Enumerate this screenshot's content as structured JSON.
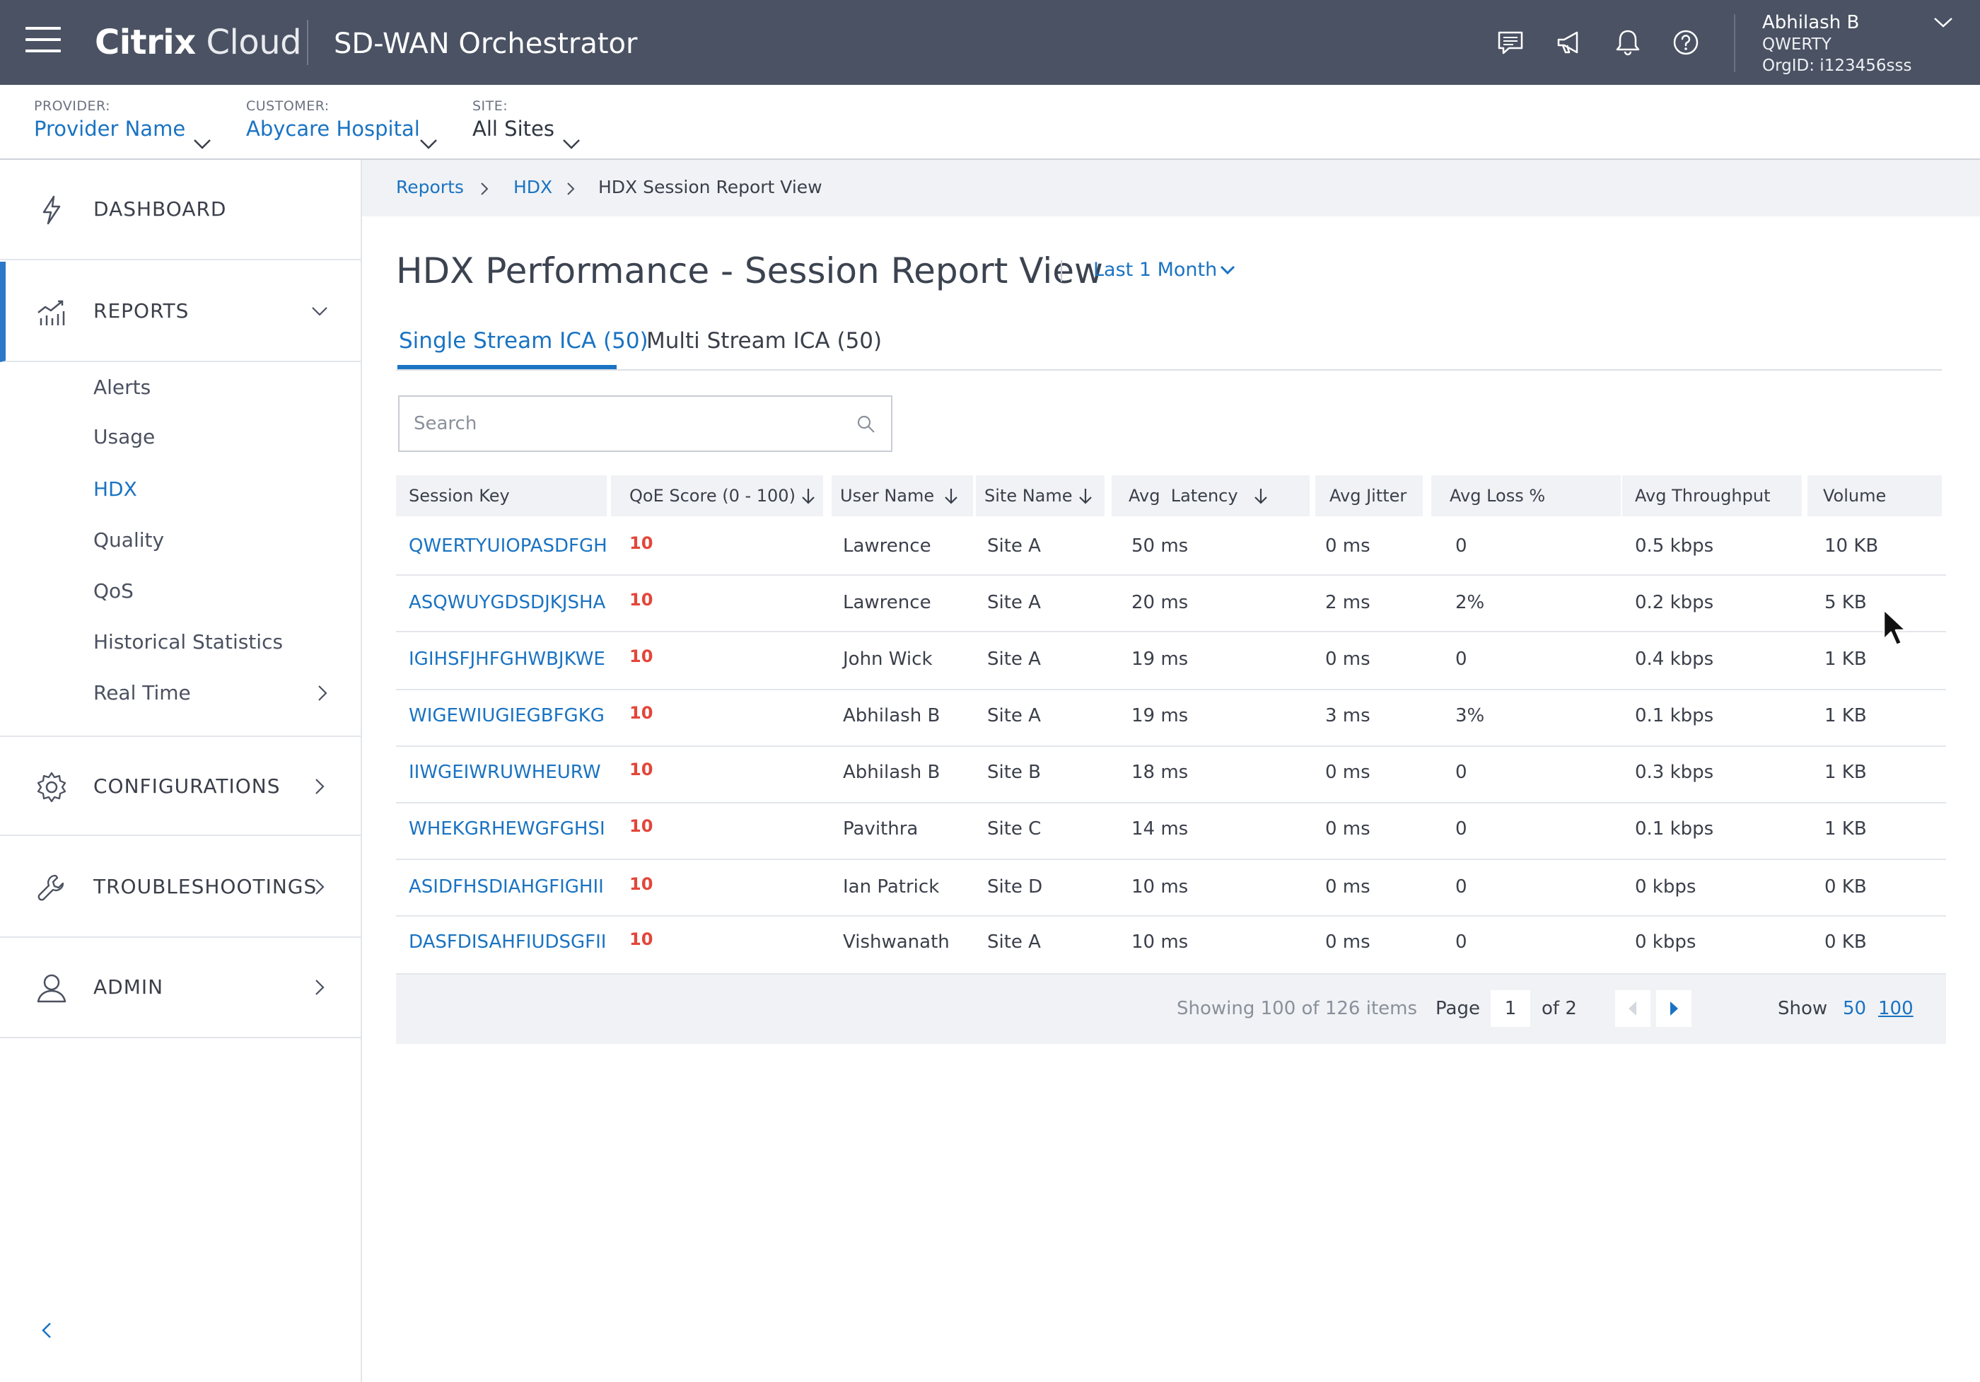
{
  "header": {
    "brand_bold": "Citrix",
    "brand_light": "Cloud",
    "product": "SD-WAN Orchestrator",
    "icons": [
      "chat-icon",
      "megaphone-icon",
      "bell-icon",
      "help-icon"
    ],
    "user": {
      "name": "Abhilash B",
      "org": "QWERTY",
      "org_id": "OrgID: i123456sss"
    }
  },
  "filters": {
    "provider": {
      "label": "PROVIDER:",
      "value": "Provider Name"
    },
    "customer": {
      "label": "CUSTOMER:",
      "value": "Abycare Hospital"
    },
    "site": {
      "label": "SITE:",
      "value": "All Sites"
    }
  },
  "sidebar": {
    "dashboard": "DASHBOARD",
    "reports": "REPORTS",
    "report_items": [
      "Alerts",
      "Usage",
      "HDX",
      "Quality",
      "QoS",
      "Historical Statistics",
      "Real Time"
    ],
    "active_item": "HDX",
    "configurations": "CONFIGURATIONS",
    "troubleshootings": "TROUBLESHOOTINGS",
    "admin": "ADMIN"
  },
  "breadcrumb": [
    "Reports",
    "HDX",
    "HDX Session Report View"
  ],
  "page": {
    "title": "HDX Performance - Session Report View",
    "range": "Last 1 Month",
    "tabs": [
      "Single Stream ICA (50)",
      "Multi Stream ICA (50)"
    ],
    "active_tab": 0,
    "search_placeholder": "Search"
  },
  "table": {
    "columns": [
      "Session Key",
      "QoE Score (0 - 100)",
      "User Name",
      "Site Name",
      "Avg  Latency",
      "Avg Jitter",
      "Avg Loss %",
      "Avg Throughput",
      "Volume"
    ],
    "rows": [
      [
        "QWERTYUIOPASDFGH",
        "10",
        "Lawrence",
        "Site A",
        "50 ms",
        "0 ms",
        "0",
        "0.5 kbps",
        "10 KB"
      ],
      [
        "ASQWUYGDSDJKJSHA",
        "10",
        "Lawrence",
        "Site A",
        "20 ms",
        "2 ms",
        "2%",
        "0.2 kbps",
        "5 KB"
      ],
      [
        "IGIHSFJHFGHWBJKWE",
        "10",
        "John Wick",
        "Site A",
        "19 ms",
        "0 ms",
        "0",
        "0.4 kbps",
        "1 KB"
      ],
      [
        "WIGEWIUGIEGBFGKG",
        "10",
        "Abhilash B",
        "Site A",
        "19 ms",
        "3 ms",
        "3%",
        "0.1 kbps",
        "1 KB"
      ],
      [
        "IIWGEIWRUWHEURW",
        "10",
        "Abhilash B",
        "Site B",
        "18 ms",
        "0 ms",
        "0",
        "0.3 kbps",
        "1 KB"
      ],
      [
        "WHEKGRHEWGFGHSI",
        "10",
        "Pavithra",
        "Site C",
        "14 ms",
        "0 ms",
        "0",
        "0.1 kbps",
        "1 KB"
      ],
      [
        "ASIDFHSDIAHGFIGHII",
        "10",
        "Ian Patrick",
        "Site D",
        "10 ms",
        "0 ms",
        "0",
        "0 kbps",
        "0 KB"
      ],
      [
        "DASFDISAHFIUDSGFII",
        "10",
        "Vishwanath",
        "Site A",
        "10 ms",
        "0 ms",
        "0",
        "0 kbps",
        "0 KB"
      ]
    ]
  },
  "pagination": {
    "showing": "Showing 100 of 126 items",
    "page_label": "Page",
    "page_value": "1",
    "of_label": "of 2",
    "show_label": "Show",
    "size_50": "50",
    "size_100": "100"
  },
  "colors": {
    "topbar": "#4a5263",
    "accent": "#1a73c2",
    "qoe_bad": "#e3463a"
  }
}
